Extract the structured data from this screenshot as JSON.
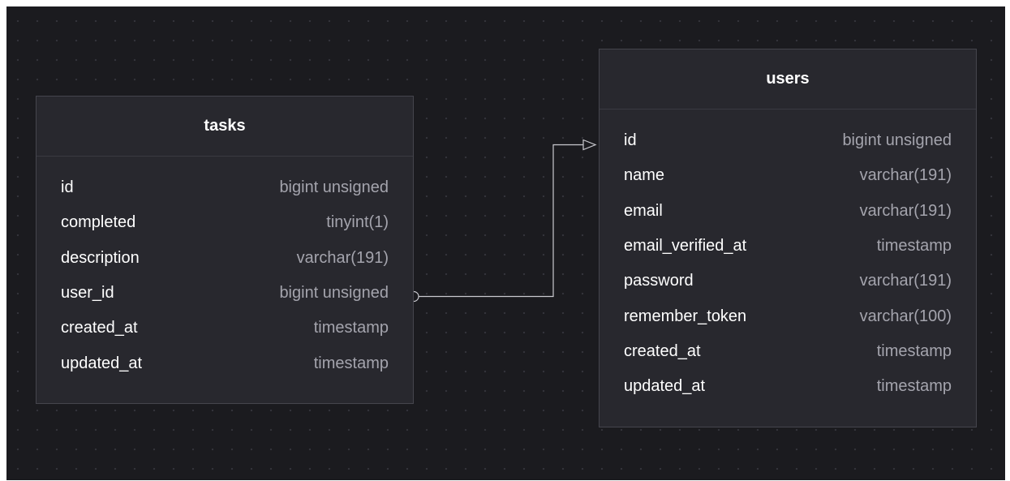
{
  "tables": {
    "tasks": {
      "name": "tasks",
      "columns": [
        {
          "name": "id",
          "type": "bigint unsigned"
        },
        {
          "name": "completed",
          "type": "tinyint(1)"
        },
        {
          "name": "description",
          "type": "varchar(191)"
        },
        {
          "name": "user_id",
          "type": "bigint unsigned"
        },
        {
          "name": "created_at",
          "type": "timestamp"
        },
        {
          "name": "updated_at",
          "type": "timestamp"
        }
      ]
    },
    "users": {
      "name": "users",
      "columns": [
        {
          "name": "id",
          "type": "bigint unsigned"
        },
        {
          "name": "name",
          "type": "varchar(191)"
        },
        {
          "name": "email",
          "type": "varchar(191)"
        },
        {
          "name": "email_verified_at",
          "type": "timestamp"
        },
        {
          "name": "password",
          "type": "varchar(191)"
        },
        {
          "name": "remember_token",
          "type": "varchar(100)"
        },
        {
          "name": "created_at",
          "type": "timestamp"
        },
        {
          "name": "updated_at",
          "type": "timestamp"
        }
      ]
    }
  },
  "relationship": {
    "from": "tasks.user_id",
    "to": "users.id"
  },
  "colors": {
    "canvas": "#1b1b1f",
    "card": "#28282e",
    "border": "#45454d",
    "text": "#ffffff",
    "type_text": "#a4a4ad",
    "connector": "#c9c9cf"
  }
}
